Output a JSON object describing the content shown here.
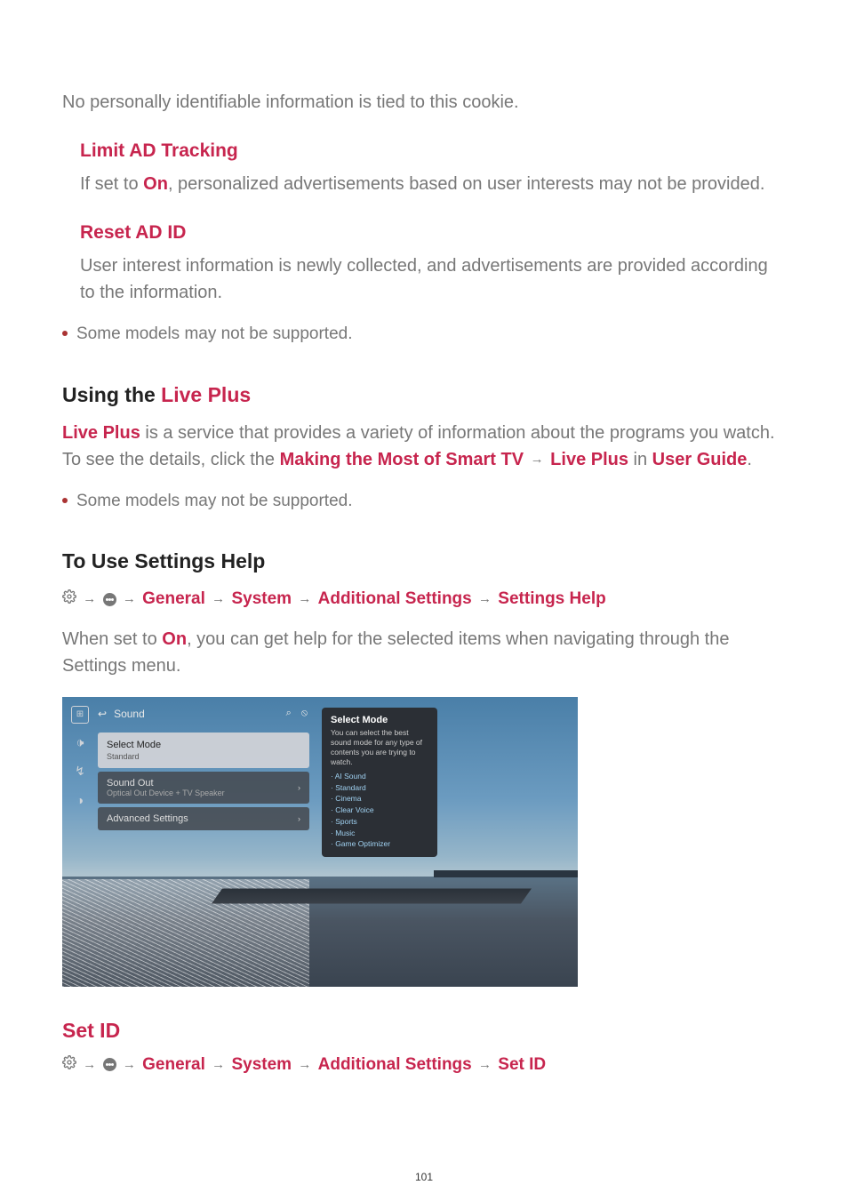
{
  "intro": "No personally identifiable information is tied to this cookie.",
  "limit": {
    "title": "Limit AD Tracking",
    "body_1": "If set to ",
    "on": "On",
    "body_2": ", personalized advertisements based on user interests may not be provided."
  },
  "reset": {
    "title": "Reset AD ID",
    "body": "User interest information is newly collected, and advertisements are provided according to the information."
  },
  "bullet_unsupported": "Some models may not be supported.",
  "liveplus": {
    "heading_1": "Using the ",
    "heading_2": "Live Plus",
    "body_1a": "Live Plus",
    "body_1b": " is a service that provides a variety of information about the programs you watch.",
    "body_2a": "To see the details, click the ",
    "link": "Making the Most of Smart TV",
    "body_2b": "Live Plus",
    "body_2c": " in ",
    "guide": "User Guide",
    "body_2d": "."
  },
  "settingshelp": {
    "heading": "To Use Settings Help",
    "crumb": {
      "a": "General",
      "b": "System",
      "c": "Additional Settings",
      "d": "Settings Help"
    },
    "body_1": "When set to ",
    "on": "On",
    "body_2": ", you can get help for the selected items when navigating through the Settings menu."
  },
  "screenshot": {
    "titlebar": {
      "back": "↩",
      "title": "Sound",
      "icons": "⌕  ⦸"
    },
    "side": {
      "a": "⊞",
      "b": "🕩",
      "c": "↯",
      "d": "◑"
    },
    "menu": {
      "item1": {
        "label": "Select Mode",
        "sub": "Standard"
      },
      "item2": {
        "label": "Sound Out",
        "sub": "Optical Out Device + TV Speaker",
        "chev": "›"
      },
      "item3": {
        "label": "Advanced Settings",
        "chev": "›"
      }
    },
    "tooltip": {
      "title": "Select Mode",
      "desc": "You can select the best sound mode for any type of contents you are trying to watch.",
      "items": [
        "· AI Sound",
        "· Standard",
        "· Cinema",
        "· Clear Voice",
        "· Sports",
        "· Music",
        "· Game Optimizer"
      ]
    }
  },
  "setid": {
    "heading": "Set ID",
    "crumb": {
      "a": "General",
      "b": "System",
      "c": "Additional Settings",
      "d": "Set ID"
    }
  },
  "page": "101"
}
